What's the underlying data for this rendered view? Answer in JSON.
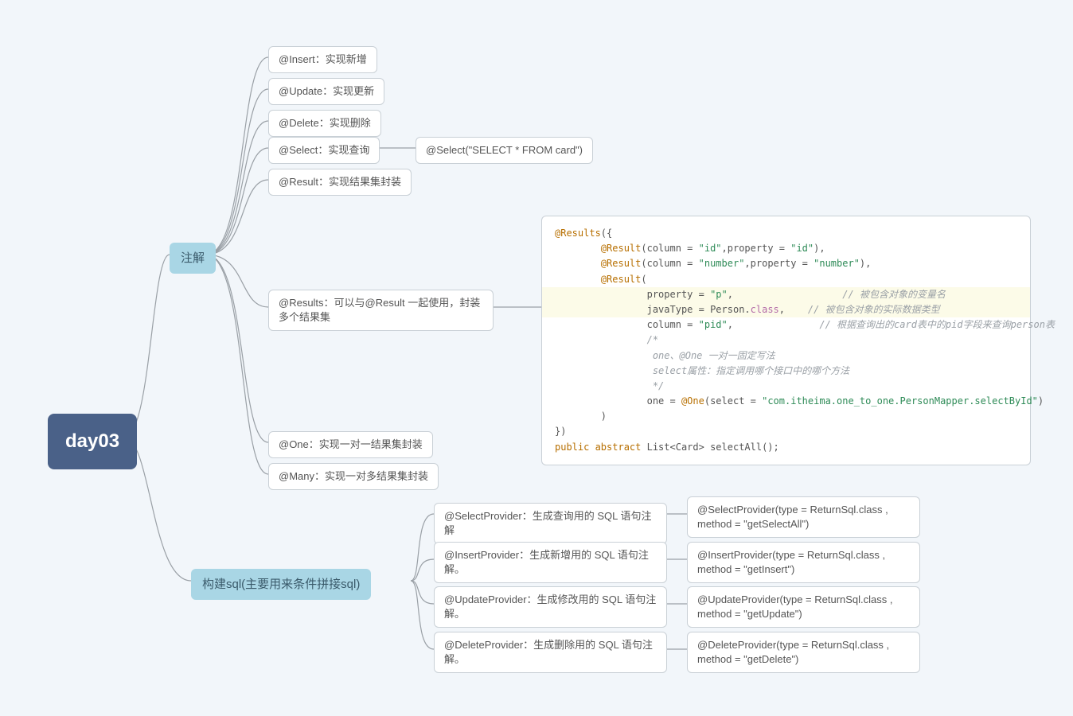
{
  "root": {
    "label": "day03"
  },
  "branches": {
    "annot": "注解",
    "sql": "构建sql(主要用来条件拼接sql)"
  },
  "annot": {
    "insert": "@Insert：实现新增",
    "update": "@Update：实现更新",
    "delete": "@Delete：实现删除",
    "select": "@Select：实现查询",
    "select_ex": "@Select(\"SELECT * FROM card\")",
    "result": "@Result：实现结果集封装",
    "results": "@Results：可以与@Result 一起使用，封装多个结果集",
    "one": "@One：实现一对一结果集封装",
    "many": "@Many：实现一对多结果集封装"
  },
  "sql": {
    "selectp": "@SelectProvider：生成查询用的 SQL 语句注解",
    "selectp_ex": " @SelectProvider(type = ReturnSql.class , method = \"getSelectAll\")",
    "insertp": "@InsertProvider：生成新增用的 SQL 语句注解。",
    "insertp_ex": " @InsertProvider(type = ReturnSql.class , method = \"getInsert\")",
    "updatep": "@UpdateProvider：生成修改用的 SQL 语句注解。",
    "updatep_ex": " @UpdateProvider(type = ReturnSql.class , method = \"getUpdate\")",
    "deletep": "@DeleteProvider：生成删除用的 SQL 语句注解。",
    "deletep_ex": " @DeleteProvider(type = ReturnSql.class , method = \"getDelete\")"
  },
  "code": {
    "l1a": "@Results",
    "l1b": "({",
    "l2a": "@Result",
    "l2b": "(column = ",
    "l2c": "\"id\"",
    "l2d": ",property = ",
    "l2e": "\"id\"",
    "l2f": "),",
    "l3a": "@Result",
    "l3b": "(column = ",
    "l3c": "\"number\"",
    "l3d": ",property = ",
    "l3e": "\"number\"",
    "l3f": "),",
    "l4a": "@Result",
    "l4b": "(",
    "l5a": "property = ",
    "l5b": "\"p\"",
    "l5c": ",",
    "l5cmt": "//  被包含对象的变量名",
    "l6a": "javaType = Person.",
    "l6b": "class",
    "l6c": ",",
    "l6cmt": "//  被包含对象的实际数据类型",
    "l7a": "column = ",
    "l7b": "\"pid\"",
    "l7c": ",",
    "l7cmt": "//  根据查询出的card表中的pid字段来查询person表",
    "l8": "/*",
    "l9": "    one、@One  一对一固定写法",
    "l10": "    select属性：指定调用哪个接口中的哪个方法",
    "l11": " */",
    "l12a": "one = ",
    "l12b": "@One",
    "l12c": "(select = ",
    "l12d": "\"com.itheima.one_to_one.PersonMapper.selectById\"",
    "l12e": ")",
    "l13": ")",
    "l14": "})",
    "l15a": "public abstract ",
    "l15b": "List<Card> selectAll();"
  }
}
